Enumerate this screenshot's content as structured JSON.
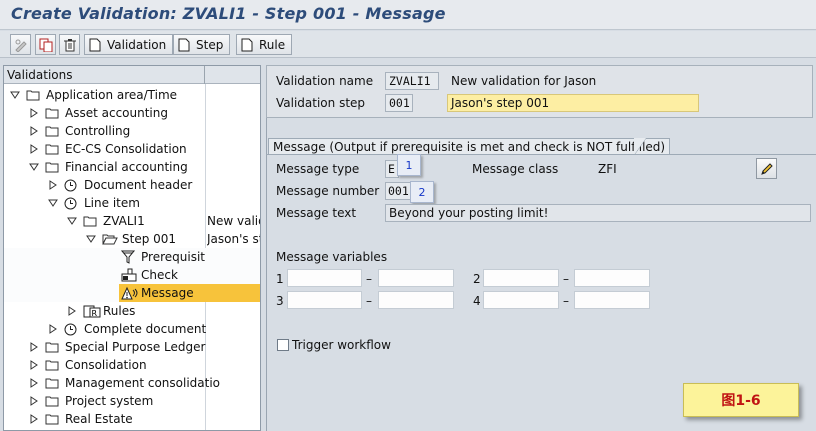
{
  "window": {
    "title": "Create Validation: ZVALI1 - Step 001 - Message"
  },
  "toolbar": {
    "validation_label": "Validation",
    "step_label": "Step",
    "rule_label": "Rule"
  },
  "tree": {
    "header": "Validations",
    "nodes": [
      {
        "label": "Application area/Time",
        "desc": ""
      },
      {
        "label": "Asset accounting",
        "desc": ""
      },
      {
        "label": "Controlling",
        "desc": ""
      },
      {
        "label": "EC-CS Consolidation",
        "desc": ""
      },
      {
        "label": "Financial accounting",
        "desc": ""
      },
      {
        "label": "Document header",
        "desc": ""
      },
      {
        "label": "Line item",
        "desc": ""
      },
      {
        "label": "ZVALI1",
        "desc": "New valid"
      },
      {
        "label": "Step 001",
        "desc": "Jason's st"
      },
      {
        "label": "Prerequisit",
        "desc": ""
      },
      {
        "label": "Check",
        "desc": ""
      },
      {
        "label": "Message",
        "desc": ""
      },
      {
        "label": "Rules",
        "desc": ""
      },
      {
        "label": "Complete document",
        "desc": ""
      },
      {
        "label": "Special Purpose Ledger",
        "desc": ""
      },
      {
        "label": "Consolidation",
        "desc": ""
      },
      {
        "label": "Management consolidatio",
        "desc": ""
      },
      {
        "label": "Project system",
        "desc": ""
      },
      {
        "label": "Real Estate",
        "desc": ""
      }
    ]
  },
  "header_fields": {
    "validation_name_label": "Validation name",
    "validation_name_value": "ZVALI1",
    "validation_name_text": "New validation for Jason",
    "validation_step_label": "Validation step",
    "validation_step_value": "001",
    "validation_step_text": "Jason's step 001"
  },
  "message_tab": {
    "title": "Message (Output if prerequisite is met and check is NOT fulfilled)",
    "type_label": "Message type",
    "type_value": "E",
    "class_label": "Message class",
    "class_value": "ZFI",
    "number_label": "Message number",
    "number_value": "001",
    "text_label": "Message text",
    "text_value": "Beyond your posting limit!",
    "variables_label": "Message variables",
    "var_rows": [
      {
        "n1": "1",
        "n2": "2"
      },
      {
        "n1": "3",
        "n2": "4"
      }
    ],
    "dash": "–",
    "trigger_workflow_label": "Trigger workflow",
    "badge1": "1",
    "badge2": "2"
  },
  "figure_label": "图1-6",
  "colors": {
    "highlight": "#f7c33b",
    "title": "#2d4c7a",
    "figure_text": "#c01313"
  }
}
